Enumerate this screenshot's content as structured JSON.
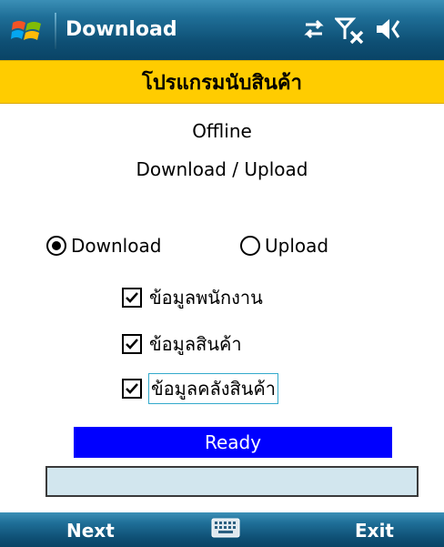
{
  "titlebar": {
    "title": "Download",
    "icons": [
      "windows-start-icon",
      "connectivity-icon",
      "no-signal-icon",
      "volume-icon"
    ]
  },
  "banner": {
    "text": "โปรแกรมนับสินค้า"
  },
  "mode": {
    "status": "Offline",
    "direction": "Download / Upload"
  },
  "options": {
    "download_label": "Download",
    "upload_label": "Upload",
    "selected": "Download"
  },
  "checkboxes": [
    {
      "label": "ข้อมูลพนักงาน",
      "checked": true
    },
    {
      "label": "ข้อมูลสินค้า",
      "checked": true
    },
    {
      "label": "ข้อมูลคลังสินค้า",
      "checked": true
    }
  ],
  "status_bar": {
    "text": "Ready",
    "color": "#0000ff"
  },
  "input_field": {
    "value": ""
  },
  "menubar": {
    "left": "Next",
    "right": "Exit",
    "center_icon": "keyboard-icon"
  },
  "colors": {
    "banner": "#ffcc00",
    "bar": "#1f6f98"
  }
}
